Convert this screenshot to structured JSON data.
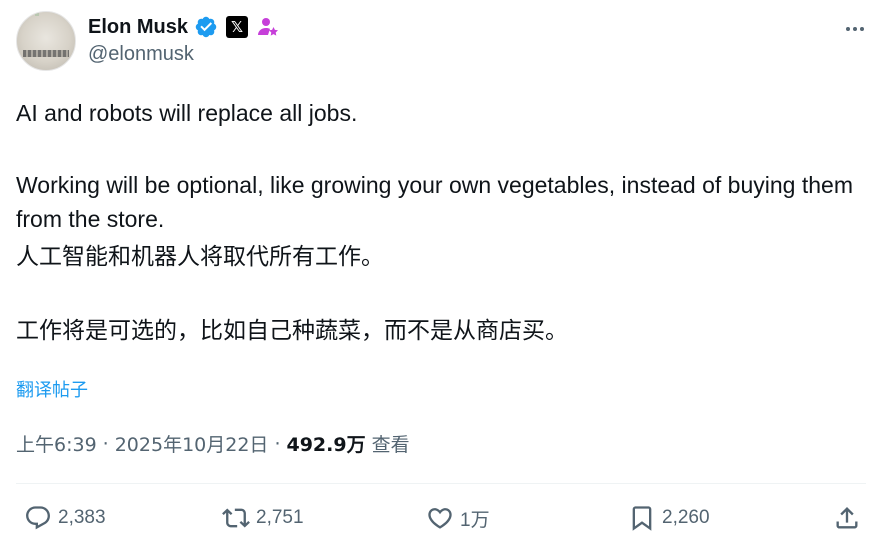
{
  "author": {
    "name": "Elon Musk",
    "handle": "@elonmusk",
    "x_badge": "𝕏"
  },
  "tweet": {
    "line1": "AI and robots will replace all jobs.",
    "line2": "Working will be optional, like growing your own vegetables, instead of buying them from the store.",
    "zh_line1": "人工智能和机器人将取代所有工作。",
    "zh_line2": "工作将是可选的，比如自己种蔬菜，而不是从商店买。"
  },
  "translate_label": "翻译帖子",
  "meta": {
    "time": "上午6:39",
    "sep1": "·",
    "date": "2025年10月22日",
    "sep2": "·",
    "views_count": "492.9万",
    "views_label": "查看"
  },
  "actions": {
    "replies": "2,383",
    "reposts": "2,751",
    "likes": "1万",
    "bookmarks": "2,260"
  },
  "colors": {
    "accent": "#1d9bf0",
    "muted": "#536471",
    "text": "#0f1419",
    "gov_badge": "#c63fd9"
  }
}
